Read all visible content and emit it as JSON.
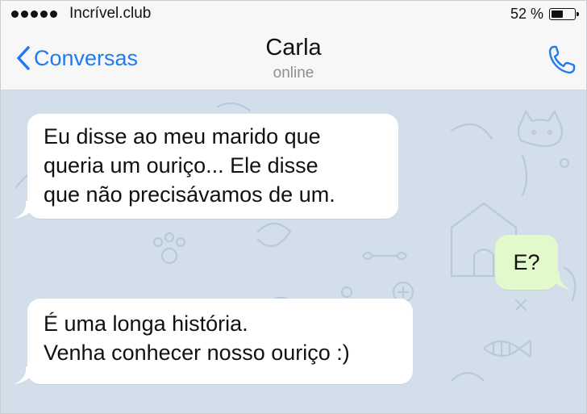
{
  "status_bar": {
    "carrier": "Incrível.club",
    "battery_percent": "52 %",
    "battery_level": 0.52
  },
  "nav": {
    "back_label": "Conversas",
    "contact_name": "Carla",
    "contact_status": "online"
  },
  "messages": [
    {
      "direction": "incoming",
      "lines": [
        "Eu disse ao meu marido que",
        "queria um ouriço... Ele disse",
        "que não precisávamos de um."
      ]
    },
    {
      "direction": "outgoing",
      "lines": [
        "E?"
      ]
    },
    {
      "direction": "incoming",
      "lines": [
        "É uma longa história.",
        "Venha conhecer nosso ouriço :)"
      ]
    }
  ],
  "colors": {
    "accent": "#1f7bf1",
    "incoming_bubble": "#ffffff",
    "outgoing_bubble": "#e2f9cb",
    "chat_background": "#d2dfeb"
  }
}
